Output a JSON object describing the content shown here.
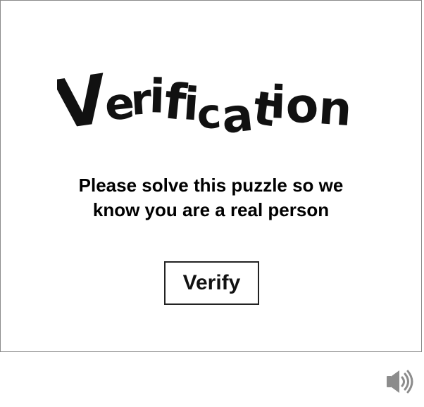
{
  "logo": {
    "text": "Verification"
  },
  "instructions": {
    "line1": "Please solve this puzzle so we",
    "line2": "know you are a real person"
  },
  "verify_button": {
    "label": "Verify"
  },
  "audio_button": {
    "icon": "speaker-icon"
  }
}
